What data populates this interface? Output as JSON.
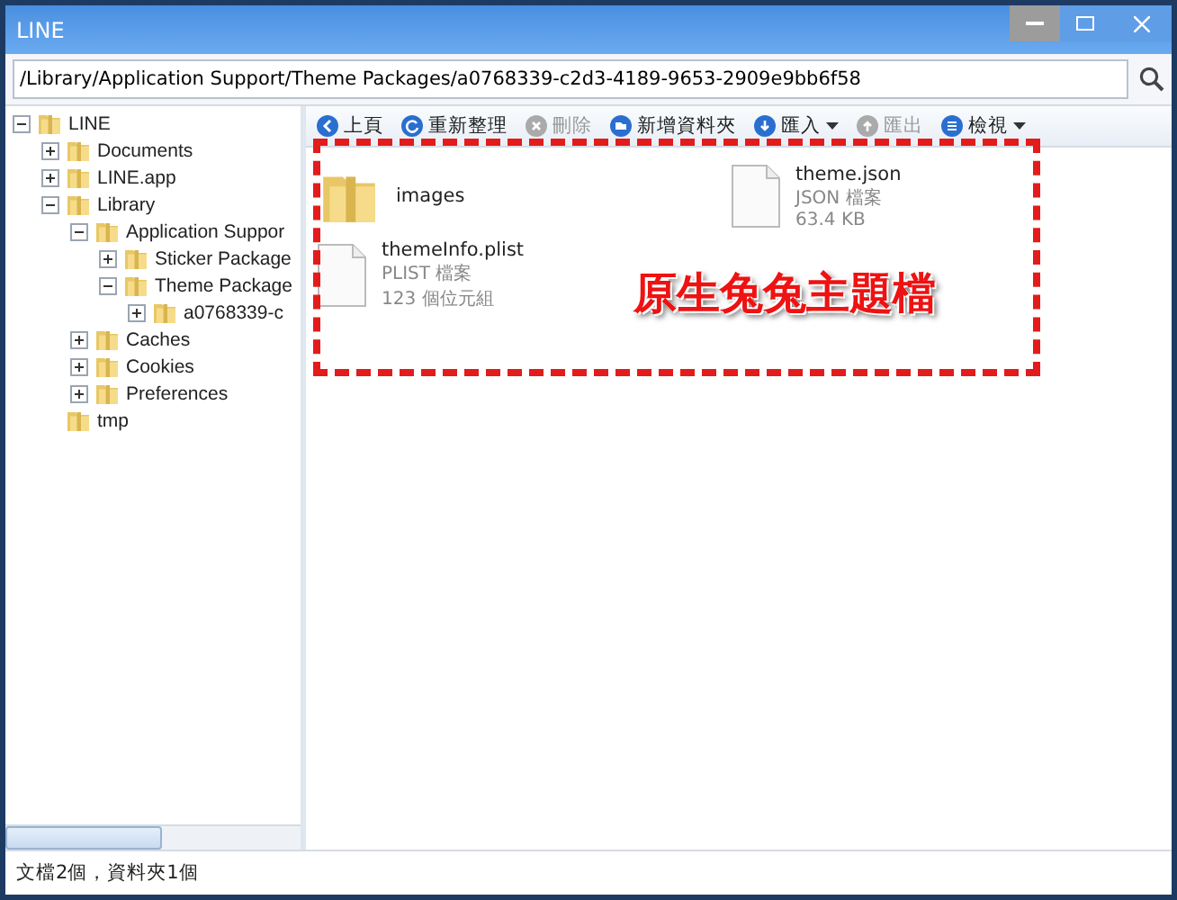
{
  "window": {
    "title": "LINE"
  },
  "address": {
    "value": "/Library/Application Support/Theme Packages/a0768339-c2d3-4189-9653-2909e9bb6f58"
  },
  "tree": [
    {
      "label": "LINE",
      "expanded": true,
      "children": [
        {
          "label": "Documents",
          "expanded": false
        },
        {
          "label": "LINE.app",
          "expanded": false
        },
        {
          "label": "Library",
          "expanded": true,
          "children": [
            {
              "label": "Application Suppor",
              "expanded": true,
              "children": [
                {
                  "label": "Sticker Package",
                  "expanded": false
                },
                {
                  "label": "Theme Package",
                  "expanded": true,
                  "children": [
                    {
                      "label": "a0768339-c",
                      "expanded": false
                    }
                  ]
                }
              ]
            },
            {
              "label": "Caches",
              "expanded": false
            },
            {
              "label": "Cookies",
              "expanded": false
            },
            {
              "label": "Preferences",
              "expanded": false
            }
          ]
        },
        {
          "label": "tmp"
        }
      ]
    }
  ],
  "toolbar": [
    {
      "label": "上頁",
      "kind": "back",
      "disabled": false,
      "dropdown": false
    },
    {
      "label": "重新整理",
      "kind": "refresh",
      "disabled": false,
      "dropdown": false
    },
    {
      "label": "刪除",
      "kind": "delete",
      "disabled": true,
      "dropdown": false
    },
    {
      "label": "新增資料夾",
      "kind": "folder",
      "disabled": false,
      "dropdown": false
    },
    {
      "label": "匯入",
      "kind": "import",
      "disabled": false,
      "dropdown": true
    },
    {
      "label": "匯出",
      "kind": "export",
      "disabled": true,
      "dropdown": false
    },
    {
      "label": "檢視",
      "kind": "view",
      "disabled": false,
      "dropdown": true
    }
  ],
  "files": [
    {
      "kind": "folder",
      "name": "images"
    },
    {
      "kind": "file",
      "name": "theme.json",
      "type": "JSON 檔案",
      "size": "63.4 KB"
    },
    {
      "kind": "file",
      "name": "themeInfo.plist",
      "type": "PLIST 檔案",
      "size": "123 個位元組"
    }
  ],
  "annotation": {
    "text": "原生兔兔主題檔"
  },
  "status_bar": {
    "text": "文檔2個，資料夾1個"
  }
}
